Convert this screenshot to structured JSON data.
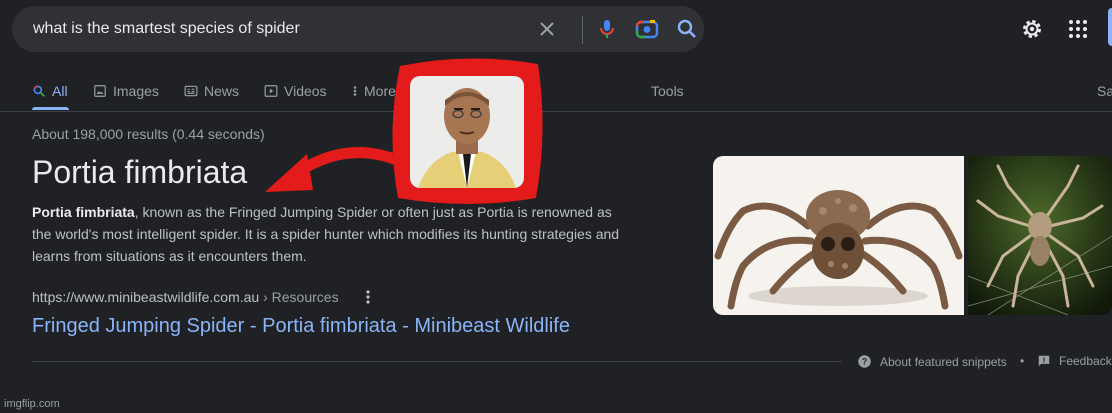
{
  "search": {
    "query": "what is the smartest species of spider"
  },
  "icons": {
    "clear": "close-icon",
    "mic": "microphone-icon",
    "lens": "camera-lens-icon",
    "search": "search-icon",
    "settings": "gear-icon",
    "apps": "apps-grid-icon"
  },
  "tabs": [
    {
      "label": "All",
      "active": true
    },
    {
      "label": "Images"
    },
    {
      "label": "News"
    },
    {
      "label": "Videos"
    },
    {
      "label": "More"
    }
  ],
  "tools_label": "Tools",
  "safesearch_partial": "Sa",
  "result_stats": "About 198,000 results (0.44 seconds)",
  "snippet": {
    "title": "Portia fimbriata",
    "bold_lead": "Portia fimbriata",
    "text": ", known as the Fringed Jumping Spider or often just as Portia is renowned as the world's most intelligent spider. It is a spider hunter which modifies its hunting strategies and learns from situations as it encounters them."
  },
  "source": {
    "url": "https://www.minibeastwildlife.com.au",
    "breadcrumb": "› Resources",
    "link_title": "Fringed Jumping Spider - Portia fimbriata - Minibeast Wildlife"
  },
  "footer": {
    "about_snippets": "About featured snippets",
    "separator": "•",
    "feedback": "Feedback"
  },
  "watermark": "imgflip.com",
  "colors": {
    "background": "#202124",
    "link": "#8ab4f8",
    "overlay_red": "#e31b1b"
  }
}
